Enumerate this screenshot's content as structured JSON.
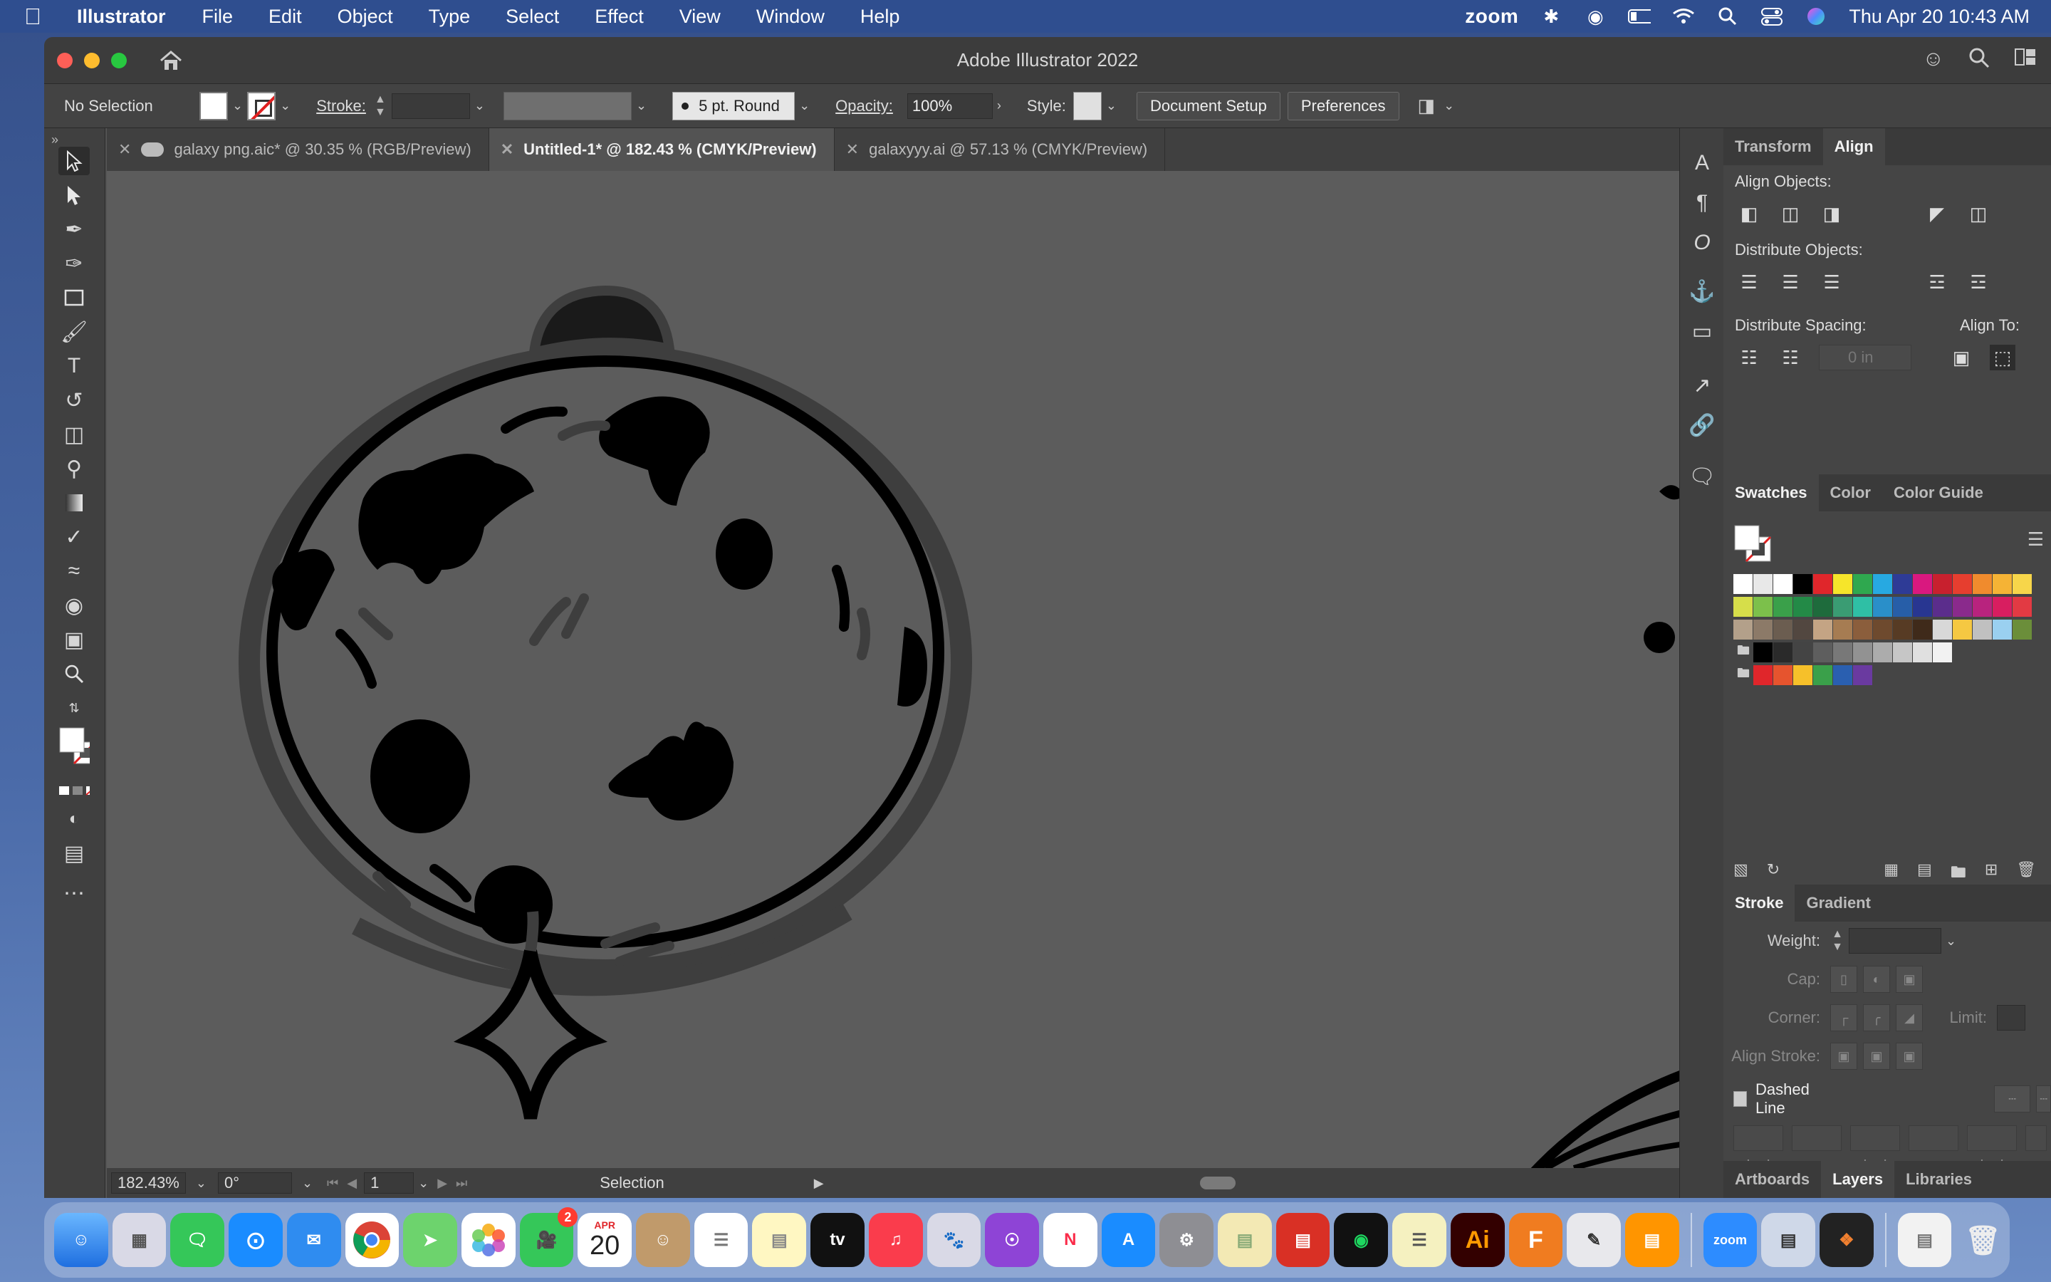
{
  "menubar": {
    "app_name": "Illustrator",
    "items": [
      "File",
      "Edit",
      "Object",
      "Type",
      "Select",
      "Effect",
      "View",
      "Window",
      "Help"
    ],
    "status_zoom": "zoom",
    "datetime": "Thu Apr 20  10:43 AM"
  },
  "window": {
    "title": "Adobe Illustrator 2022"
  },
  "controlbar": {
    "selection": "No Selection",
    "stroke_label": "Stroke:",
    "brush": "5 pt. Round",
    "opacity_label": "Opacity:",
    "opacity_value": "100%",
    "style_label": "Style:",
    "document_setup": "Document Setup",
    "preferences": "Preferences"
  },
  "tabs": [
    {
      "label": "galaxy png.aic* @ 30.35 % (RGB/Preview)"
    },
    {
      "label": "Untitled-1* @ 182.43 % (CMYK/Preview)"
    },
    {
      "label": "galaxyyy.ai @ 57.13 % (CMYK/Preview)"
    }
  ],
  "statusbar": {
    "zoom": "182.43%",
    "rotation": "0°",
    "artboard": "1",
    "tool": "Selection"
  },
  "align_panel": {
    "tabs": [
      "Transform",
      "Align"
    ],
    "align_objects": "Align Objects:",
    "distribute_objects": "Distribute Objects:",
    "distribute_spacing": "Distribute Spacing:",
    "align_to": "Align To:",
    "spacing_placeholder": "0 in"
  },
  "swatches_panel": {
    "tabs": [
      "Swatches",
      "Color",
      "Color Guide"
    ],
    "rows": [
      [
        "#ffffff",
        "#e8e8e8",
        "#ffffff",
        "#000000",
        "#e0262b",
        "#f6e52a",
        "#2fa84f",
        "#27a9e1",
        "#2e3b96",
        "#d9187f",
        "#c8202e",
        "#e63e2f",
        "#f08b2d",
        "#f5b335",
        "#f7d64a"
      ],
      [
        "#d6de4a",
        "#7cc04b",
        "#3aa04a",
        "#238a47",
        "#1e6b3c",
        "#3a9c73",
        "#2fbfa5",
        "#2a8fc9",
        "#275ea8",
        "#283691",
        "#5b2d8c",
        "#8a2a8c",
        "#b8237e",
        "#d81e60",
        "#e23a43"
      ],
      [
        "#b3a08a",
        "#8c7a68",
        "#6b5d50",
        "#524740",
        "#c4a484",
        "#a67c52",
        "#8b5e3c",
        "#6e4a2e",
        "#573b24",
        "#3f2a1a",
        "#d8d8d8",
        "#f5c842",
        "#c0c0c0",
        "#9ad0f0",
        "#6b8e3a"
      ],
      [
        "#000000",
        "#2a2a2a",
        "#444444",
        "#5e5e5e",
        "#787878",
        "#929292",
        "#acacac",
        "#c6c6c6",
        "#e0e0e0",
        "#f2f2f2"
      ],
      [
        "#e0262b",
        "#e6542e",
        "#f6c02a",
        "#3aa04a",
        "#2a5fb0",
        "#6a3aa0"
      ]
    ]
  },
  "stroke_panel": {
    "tabs": [
      "Stroke",
      "Gradient"
    ],
    "weight_label": "Weight:",
    "cap_label": "Cap:",
    "corner_label": "Corner:",
    "limit_label": "Limit:",
    "align_stroke_label": "Align Stroke:",
    "dashed_line": "Dashed Line",
    "dash_labels": [
      "dash",
      "gap",
      "dash",
      "gap",
      "dash",
      "g"
    ]
  },
  "bottom_tabs": [
    "Artboards",
    "Layers",
    "Libraries"
  ],
  "dock": {
    "calendar_month": "APR",
    "calendar_day": "20",
    "facetime_badge": "2",
    "illustrator": "Ai",
    "fusion": "F",
    "zoom": "zoom"
  }
}
